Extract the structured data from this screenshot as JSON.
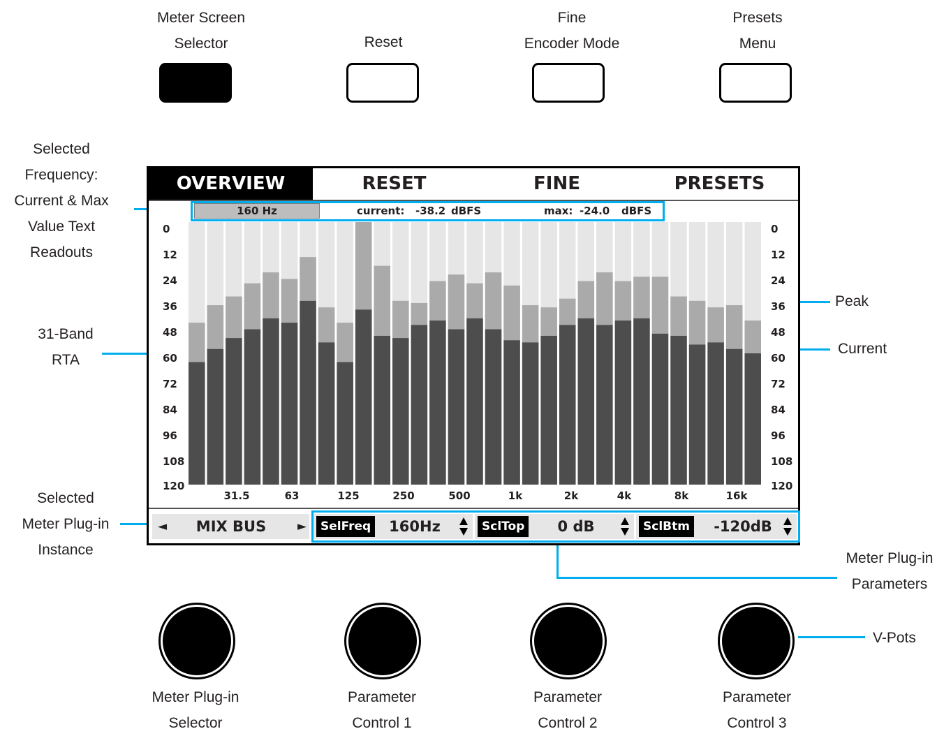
{
  "hardware_buttons": [
    {
      "label_lines": [
        "Meter Screen",
        "Selector"
      ],
      "active": true
    },
    {
      "label_lines": [
        "Reset"
      ],
      "active": false
    },
    {
      "label_lines": [
        "Fine",
        "Encoder Mode"
      ],
      "active": false
    },
    {
      "label_lines": [
        "Presets",
        "Menu"
      ],
      "active": false
    }
  ],
  "callouts": {
    "selected_frequency": [
      "Selected",
      "Frequency:",
      "Current & Max",
      "Value Text",
      "Readouts"
    ],
    "rta": [
      "31-Band",
      "RTA"
    ],
    "plugin_instance": [
      "Selected",
      "Meter Plug-in",
      "Instance"
    ],
    "peak": "Peak",
    "current": "Current",
    "plugin_parameters": [
      "Meter Plug-in",
      "Parameters"
    ],
    "vpots": "V-Pots"
  },
  "screen": {
    "tabs": [
      {
        "label": "OVERVIEW",
        "active": true
      },
      {
        "label": "RESET",
        "active": false
      },
      {
        "label": "FINE",
        "active": false
      },
      {
        "label": "PRESETS",
        "active": false
      }
    ],
    "readout": {
      "frequency": "160 Hz",
      "current_label": "current:",
      "current_value": "-38.2",
      "current_unit": "dBFS",
      "max_label": "max:",
      "max_value": "-24.0",
      "max_unit": "dBFS"
    },
    "scale_ticks": [
      "0",
      "12",
      "24",
      "36",
      "48",
      "60",
      "72",
      "84",
      "96",
      "108",
      "120"
    ],
    "plugin": {
      "left_arrow": "◄",
      "name": "MIX BUS",
      "right_arrow": "►"
    },
    "params": [
      {
        "name": "SelFreq",
        "value": "160Hz"
      },
      {
        "name": "SclTop",
        "value": "0 dB"
      },
      {
        "name": "SclBtm",
        "value": "-120dB"
      }
    ]
  },
  "chart_data": {
    "type": "bar",
    "x_tick_labels": [
      "31.5",
      "63",
      "125",
      "250",
      "500",
      "1k",
      "2k",
      "4k",
      "8k",
      "16k"
    ],
    "y_axis": {
      "range": [
        0,
        120
      ],
      "inverted": true,
      "ticks": [
        0,
        12,
        24,
        36,
        48,
        60,
        72,
        84,
        96,
        108,
        120
      ]
    },
    "band_count": 31,
    "selected_band": 9,
    "series": [
      {
        "name": "Peak",
        "values": [
          46,
          38,
          34,
          28,
          23,
          26,
          16,
          39,
          46,
          0,
          20,
          36,
          37,
          27,
          24,
          28,
          23,
          29,
          38,
          39,
          35,
          27,
          23,
          27,
          25,
          25,
          34,
          36,
          39,
          38,
          45
        ]
      },
      {
        "name": "Current",
        "values": [
          64,
          58,
          53,
          49,
          44,
          46,
          36,
          55,
          64,
          40,
          52,
          53,
          47,
          45,
          49,
          44,
          49,
          54,
          55,
          52,
          47,
          44,
          47,
          45,
          44,
          51,
          52,
          56,
          55,
          58,
          60
        ]
      }
    ],
    "colors": {
      "unlit": "#e6e6e6",
      "peak": "#aaaaaa",
      "current": "#4d4d4d",
      "highlight": "#00aeef"
    }
  },
  "knobs": [
    {
      "label_lines": [
        "Meter Plug-in",
        "Selector"
      ]
    },
    {
      "label_lines": [
        "Parameter",
        "Control 1"
      ]
    },
    {
      "label_lines": [
        "Parameter",
        "Control 2"
      ]
    },
    {
      "label_lines": [
        "Parameter",
        "Control 3"
      ]
    }
  ]
}
